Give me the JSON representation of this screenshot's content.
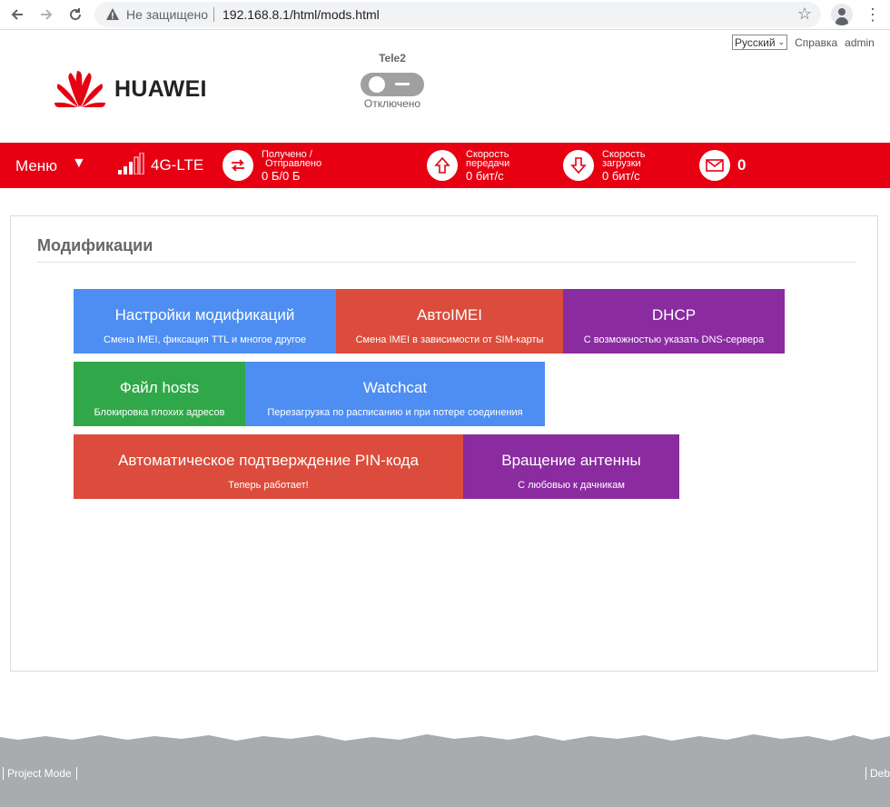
{
  "browser": {
    "not_secure": "Не защищено",
    "url": "192.168.8.1/html/mods.html"
  },
  "header": {
    "language": "Русский",
    "help": "Справка",
    "user": "admin",
    "brand": "HUAWEI",
    "operator": "Tele2",
    "connection_status": "Отключено"
  },
  "statusbar": {
    "menu": "Меню",
    "menu_arrow": "▼",
    "network": "4G-LTE",
    "traffic_label_1": "Получено /",
    "traffic_label_2": "Отправлено",
    "traffic_value": "0 Б/0 Б",
    "upload_label_1": "Скорость",
    "upload_label_2": "передачи",
    "upload_value": "0 бит/с",
    "download_label_1": "Скорость",
    "download_label_2": "загрузки",
    "download_value": "0 бит/с",
    "messages": "0"
  },
  "main": {
    "title": "Модификации",
    "tiles": [
      {
        "title": "Настройки модификаций",
        "subtitle": "Смена IMEI, фиксация TTL и многое другое",
        "color": "#4e8ef2"
      },
      {
        "title": "АвтоIMEI",
        "subtitle": "Смена IMEI в зависимости от SIM-карты",
        "color": "#db4c3c"
      },
      {
        "title": "DHCP",
        "subtitle": "С возможностью указать DNS-сервера",
        "color": "#8a2ba0"
      },
      {
        "title": "Файл hosts",
        "subtitle": "Блокировка плохих адресов",
        "color": "#30a84a"
      },
      {
        "title": "Watchcat",
        "subtitle": "Перезагрузка по расписанию и при потере соединения",
        "color": "#4e8ef2"
      },
      {
        "title": "Автоматическое подтверждение PIN-кода",
        "subtitle": "Теперь работает!",
        "color": "#db4c3c"
      },
      {
        "title": "Вращение антенны",
        "subtitle": "С любовью к дачникам",
        "color": "#8a2ba0"
      }
    ]
  },
  "footer": {
    "project_mode": "Project Mode",
    "debug": "Deb"
  },
  "colors": {
    "brand_red": "#e60012",
    "footer_gray": "#a9acaf"
  }
}
